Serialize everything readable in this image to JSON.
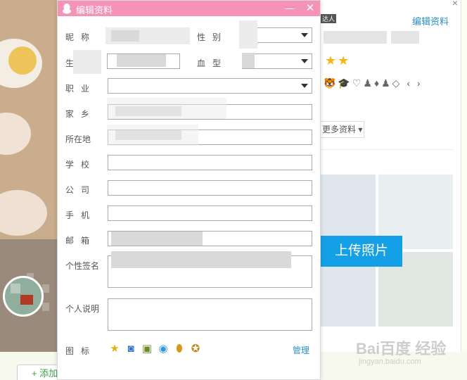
{
  "dialog": {
    "title": "编辑资料",
    "minimize_glyph": "—",
    "close_glyph": "✕"
  },
  "form": {
    "nickname_label": "昵称",
    "gender_label": "性别",
    "birthday_label": "生日",
    "blood_label": "血型",
    "job_label": "职业",
    "hometown_label": "家乡",
    "location_label": "所在地",
    "school_label": "学校",
    "company_label": "公司",
    "phone_label": "手机",
    "email_label": "邮箱",
    "signature_label": "个性签名",
    "description_label": "个人说明",
    "icons_label": "图标",
    "manage_label": "管理"
  },
  "icons": [
    "star-icon",
    "camera-icon",
    "gift-box-icon",
    "eye-icon",
    "shield-badge-icon",
    "pet-icon"
  ],
  "profile": {
    "edit_link": "编辑资料",
    "tag": "达人",
    "more_button": "更多资料 ▾",
    "upload_button": "上传照片"
  },
  "bottom": {
    "add_button": "+ 添加"
  },
  "colors": {
    "titlebar": "#f592b8",
    "link": "#2a8fc8",
    "upload": "#14a0e6"
  }
}
